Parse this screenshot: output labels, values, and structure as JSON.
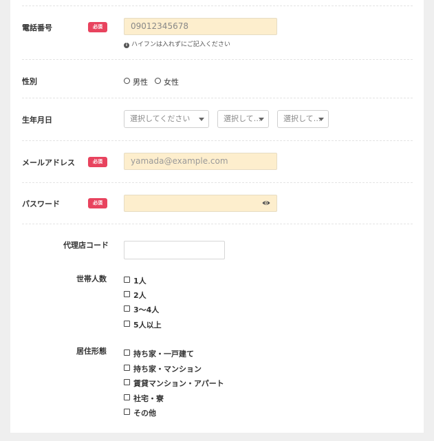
{
  "required_badge": "必須",
  "phone": {
    "label": "電話番号",
    "value": "09012345678",
    "hint_icon": "info-icon",
    "hint": "ハイフンは入れずにご記入ください"
  },
  "gender": {
    "label": "性別",
    "options": [
      "男性",
      "女性"
    ]
  },
  "birthdate": {
    "label": "生年月日",
    "year": "選択してください",
    "month": "選択して…",
    "day": "選択して…"
  },
  "email": {
    "label": "メールアドレス",
    "placeholder": "yamada@example.com"
  },
  "password": {
    "label": "パスワード",
    "toggle_icon": "eye-icon"
  },
  "agency_code": {
    "label": "代理店コード",
    "value": ""
  },
  "household": {
    "label": "世帯人数",
    "options": [
      "1人",
      "2人",
      "3〜4人",
      "5人以上"
    ]
  },
  "residence": {
    "label": "居住形態",
    "options": [
      "持ち家・一戸建て",
      "持ち家・マンション",
      "賃貸マンション・アパート",
      "社宅・寮",
      "その他"
    ]
  },
  "colors": {
    "page_bg": "#efefef",
    "input_fill": "#fdeecd",
    "required_badge": "#e8435e"
  }
}
